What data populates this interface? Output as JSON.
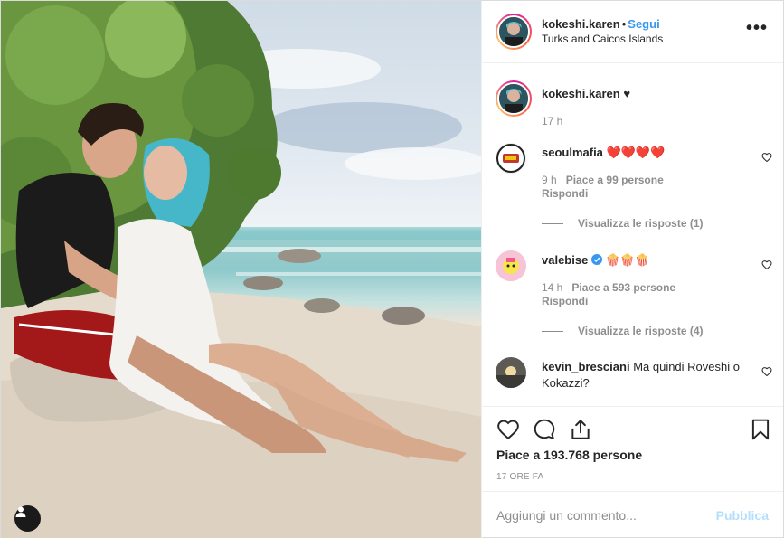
{
  "post": {
    "username": "kokeshi.karen",
    "follow_label": "Segui",
    "location": "Turks and Caicos Islands",
    "more_label": "•••",
    "caption": {
      "username": "kokeshi.karen",
      "text": "♥",
      "time": "17 h"
    },
    "comments": [
      {
        "username": "seoulmafia",
        "text": "❤️❤️❤️❤️",
        "time": "9 h",
        "likes": "Piace a 99 persone",
        "reply": "Rispondi",
        "view_replies": "Visualizza le risposte (1)"
      },
      {
        "username": "valebise",
        "verified": true,
        "text": "🍿🍿🍿",
        "time": "14 h",
        "likes": "Piace a 593 persone",
        "reply": "Rispondi",
        "view_replies": "Visualizza le risposte (4)"
      },
      {
        "username": "kevin_bresciani",
        "text": "Ma quindi Roveshi o Kokazzi?"
      }
    ],
    "likes_count": "Piace a 193.768 persone",
    "date": "17 ORE FA",
    "comment_placeholder": "Aggiungi un commento...",
    "publish_label": "Pubblica"
  },
  "colors": {
    "accent": "#3897f0",
    "publish_disabled": "#b2dffc",
    "muted": "#8e8e8e",
    "text": "#262626"
  },
  "icons": [
    "user-tag-icon",
    "more-options-icon",
    "heart-icon",
    "comment-icon",
    "share-icon",
    "bookmark-icon",
    "verified-badge-icon"
  ]
}
